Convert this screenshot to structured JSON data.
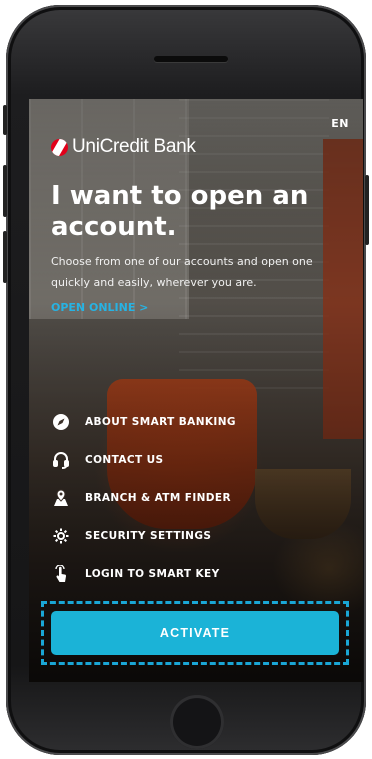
{
  "header": {
    "language": "EN",
    "brand": "UniCredit Bank"
  },
  "hero": {
    "headline": "I want to open an account.",
    "description": "Choose from one of our accounts and open one quickly and easily, wherever you are.",
    "open_online_link": "OPEN ONLINE  >"
  },
  "menu": {
    "items": [
      {
        "label": "ABOUT SMART BANKING",
        "icon": "compass-icon"
      },
      {
        "label": "CONTACT US",
        "icon": "headset-icon"
      },
      {
        "label": "BRANCH & ATM FINDER",
        "icon": "map-pin-icon"
      },
      {
        "label": "SECURITY SETTINGS",
        "icon": "gear-icon"
      },
      {
        "label": "LOGIN TO SMART KEY",
        "icon": "touch-icon"
      }
    ]
  },
  "cta": {
    "activate_label": "ACTIVATE"
  },
  "colors": {
    "accent": "#1BB3D7",
    "link": "#27B3E3",
    "brand_red": "#E2001A"
  }
}
